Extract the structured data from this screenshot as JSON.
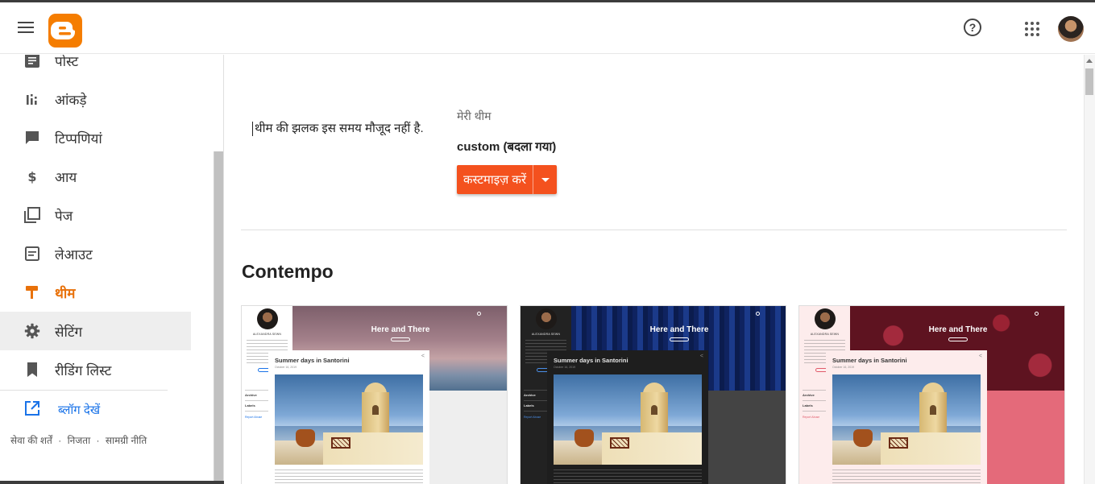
{
  "header": {
    "menu_icon": "hamburger-menu-icon",
    "logo_icon": "blogger-logo-icon",
    "help_icon": "help-circle-icon",
    "apps_icon": "apps-grid-icon",
    "avatar": "user-avatar",
    "help_glyph": "?"
  },
  "sidebar": {
    "items": [
      {
        "label": "पोस्ट",
        "icon": "posts-icon"
      },
      {
        "label": "आंकड़े",
        "icon": "stats-icon"
      },
      {
        "label": "टिप्पणियां",
        "icon": "comments-icon"
      },
      {
        "label": "आय",
        "icon": "dollar-icon"
      },
      {
        "label": "पेज",
        "icon": "pages-icon"
      },
      {
        "label": "लेआउट",
        "icon": "layout-icon"
      },
      {
        "label": "थीम",
        "icon": "theme-paint-roller-icon",
        "active": true
      },
      {
        "label": "सेटिंग",
        "icon": "gear-icon"
      },
      {
        "label": "रीडिंग लिस्ट",
        "icon": "bookmark-icon"
      }
    ],
    "view_blog_label": "ब्लॉग देखें",
    "view_blog_icon": "open-in-new-icon",
    "footer_links": [
      "सेवा की शर्तें",
      "निजता",
      "सामग्री नीति"
    ],
    "footer_separator": "·"
  },
  "main": {
    "preview_unavailable": "थीम की झलक इस समय मौजूद नहीं है.",
    "my_theme_label": "मेरी थीम",
    "current_theme_name": "custom (बदला गया)",
    "customize_button_label": "कस्टमाइज़ करें",
    "customize_dropdown_icon": "caret-down-icon",
    "section_title": "Contempo"
  },
  "theme_cards": [
    {
      "variant": "light",
      "blog_title": "Here and There",
      "post_title": "Summer days in Santorini",
      "post_date": "October 16, 2019",
      "author": "ALEXANDRA SEWN",
      "archive": "Archive",
      "labels": "Labels",
      "report": "Report Abuse",
      "colors": {
        "side": "#ffffff",
        "hero": "#8a6e74",
        "lower": "#eeeeee",
        "post": "#ffffff",
        "text": "#333333",
        "accent": "#1a73e8"
      }
    },
    {
      "variant": "dark",
      "blog_title": "Here and There",
      "post_title": "Summer days in Santorini",
      "post_date": "October 16, 2019",
      "author": "ALEXANDRA SEWN",
      "archive": "Archive",
      "labels": "Labels",
      "report": "Report Abuse",
      "colors": {
        "side": "#222222",
        "hero": "#142a6a",
        "lower": "#444444",
        "post": "#1e1e1e",
        "text": "#e6e6e6",
        "accent": "#4a8ee8"
      }
    },
    {
      "variant": "pink",
      "blog_title": "Here and There",
      "post_title": "Summer days in Santorini",
      "post_date": "October 16, 2019",
      "author": "ALEXANDRA SEWN",
      "archive": "Archive",
      "labels": "Labels",
      "report": "Report Abuse",
      "colors": {
        "side": "#fdecec",
        "hero": "#6b1624",
        "lower": "#e46a7a",
        "post": "#fdecec",
        "text": "#333333",
        "accent": "#e05a6a"
      }
    }
  ],
  "colors": {
    "brand_orange": "#f57d00",
    "active_nav": "#e8710a",
    "customize_button": "#f4511e",
    "link_blue": "#1a73e8"
  }
}
